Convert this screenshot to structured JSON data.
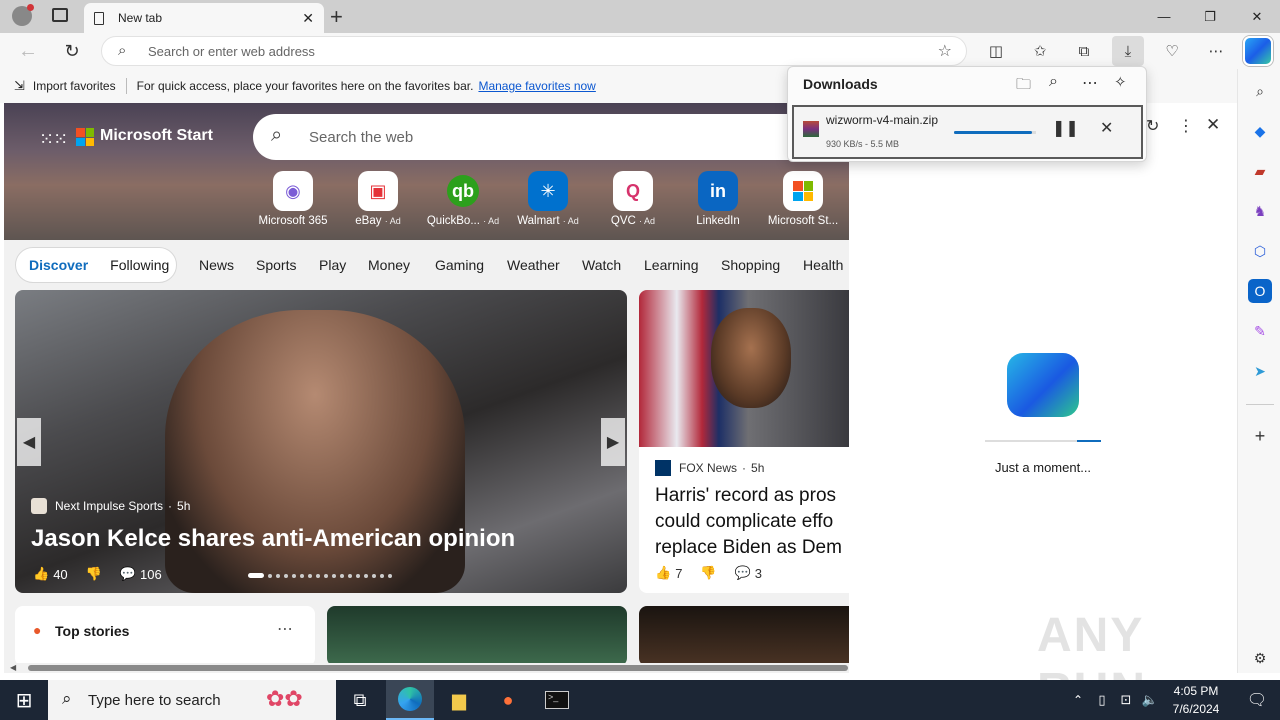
{
  "browser": {
    "tab_title": "New tab",
    "address_placeholder": "Search or enter web address",
    "favbar": {
      "import_label": "Import favorites",
      "hint": "For quick access, place your favorites here on the favorites bar.",
      "manage_link": "Manage favorites now"
    }
  },
  "page": {
    "brand": "Microsoft Start",
    "search_placeholder": "Search the web",
    "quick_links": [
      {
        "label": "Microsoft 365",
        "ad": ""
      },
      {
        "label": "eBay",
        "ad": "· Ad"
      },
      {
        "label": "QuickBo...",
        "ad": "· Ad"
      },
      {
        "label": "Walmart",
        "ad": "· Ad"
      },
      {
        "label": "QVC",
        "ad": "· Ad"
      },
      {
        "label": "LinkedIn",
        "ad": ""
      },
      {
        "label": "Microsoft St...",
        "ad": ""
      }
    ],
    "feed_tabs": [
      "Discover",
      "Following"
    ],
    "nav_items": [
      "News",
      "Sports",
      "Play",
      "Money",
      "Gaming",
      "Weather",
      "Watch",
      "Learning",
      "Shopping",
      "Health"
    ],
    "hero_card": {
      "source": "Next Impulse Sports",
      "age": "5h",
      "headline": "Jason Kelce shares anti-American opinion",
      "likes": "40",
      "comments": "106"
    },
    "side_card": {
      "source": "FOX News",
      "age": "5h",
      "headline": "Harris' record as pros could complicate effo replace Biden as Dem",
      "likes": "7",
      "comments": "3"
    },
    "top_stories_title": "Top stories"
  },
  "downloads": {
    "title": "Downloads",
    "file_name": "wizworm-v4-main.zip",
    "status": "930 KB/s - 5.5 MB",
    "progress": 0.95
  },
  "right_panel": {
    "loading_text": "Just a moment..."
  },
  "taskbar": {
    "search_placeholder": "Type here to search",
    "time": "4:05 PM",
    "date": "7/6/2024"
  },
  "watermark": "ANY RUN"
}
